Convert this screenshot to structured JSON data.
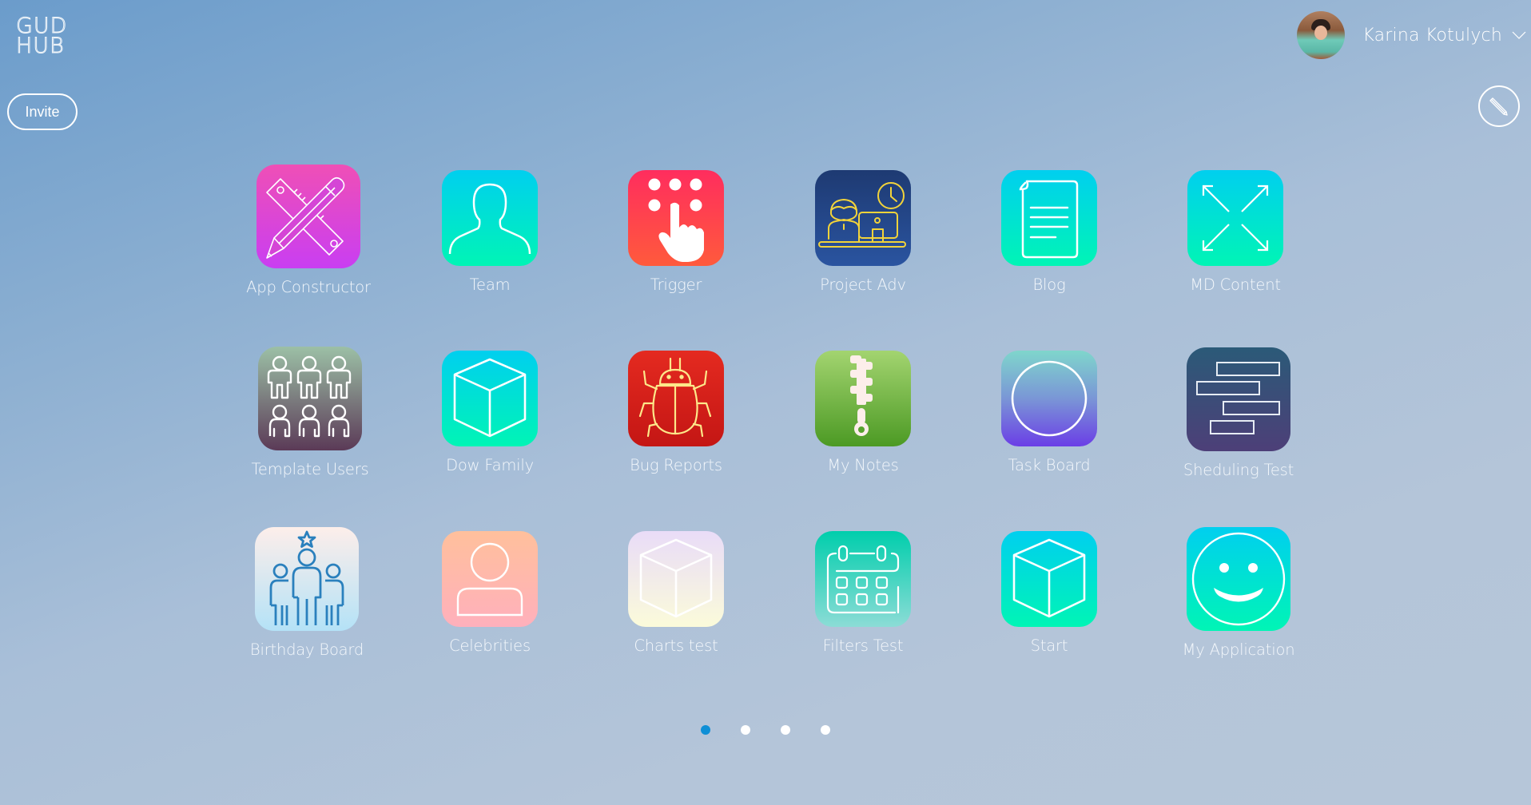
{
  "header": {
    "logo_line1": "GUD",
    "logo_line2": "HUB",
    "invite_label": "Invite",
    "user_name": "Karina Kotulych",
    "user_menu_icon": "chevron-down-icon",
    "edit_icon": "pencil-icon"
  },
  "apps": [
    {
      "label": "App Constructor",
      "icon": "pencil-ruler-icon",
      "gradient": [
        "#ef4fb6",
        "#c93ef2"
      ]
    },
    {
      "label": "Team",
      "icon": "person-silhouette-icon",
      "gradient": [
        "#00cfef",
        "#00f5b5"
      ]
    },
    {
      "label": "Trigger",
      "icon": "touch-keypad-icon",
      "gradient": [
        "#ff2d5e",
        "#ff5a3c"
      ]
    },
    {
      "label": "Project Adv",
      "icon": "person-computer-clock-icon",
      "gradient": [
        "#1e3a72",
        "#2a54a0"
      ]
    },
    {
      "label": "Blog",
      "icon": "document-icon",
      "gradient": [
        "#00cfef",
        "#00f5b5"
      ]
    },
    {
      "label": "MD Content",
      "icon": "expand-arrows-icon",
      "gradient": [
        "#00cfef",
        "#00f5b5"
      ]
    },
    {
      "label": "Template Users",
      "icon": "users-group-icon",
      "gradient": [
        "#9cc0a6",
        "#5b3a57"
      ]
    },
    {
      "label": "Dow Family",
      "icon": "cube-icon",
      "gradient": [
        "#00cfef",
        "#00f5b5"
      ]
    },
    {
      "label": "Bug Reports",
      "icon": "bug-icon",
      "gradient": [
        "#e42a20",
        "#c41614"
      ]
    },
    {
      "label": "My Notes",
      "icon": "zipper-icon",
      "gradient": [
        "#a3d470",
        "#4c9a24"
      ]
    },
    {
      "label": "Task Board",
      "icon": "circle-icon",
      "gradient": [
        "#7fd6cc",
        "#6b3ee6"
      ]
    },
    {
      "label": "Sheduling Test",
      "icon": "gantt-bars-icon",
      "gradient": [
        "#2b5a78",
        "#4d3f78"
      ]
    },
    {
      "label": "Birthday Board",
      "icon": "people-star-icon",
      "gradient": [
        "#fdeeea",
        "#b4e2f7"
      ]
    },
    {
      "label": "Celebrities",
      "icon": "user-icon",
      "gradient": [
        "#ffc09c",
        "#ffb0bc"
      ]
    },
    {
      "label": "Charts test",
      "icon": "cube-icon",
      "gradient": [
        "#e9dcf8",
        "#fbfbda"
      ]
    },
    {
      "label": "Filters Test",
      "icon": "calendar-icon",
      "gradient": [
        "#00ceac",
        "#8cdcd6"
      ]
    },
    {
      "label": "Start",
      "icon": "cube-icon",
      "gradient": [
        "#00cfef",
        "#00f5b5"
      ]
    },
    {
      "label": "My Application",
      "icon": "smiley-icon",
      "gradient": [
        "#00cfef",
        "#00f5b5"
      ]
    }
  ],
  "pagination": {
    "pages": 4,
    "current": 1,
    "active_color": "#0f8fd6"
  }
}
